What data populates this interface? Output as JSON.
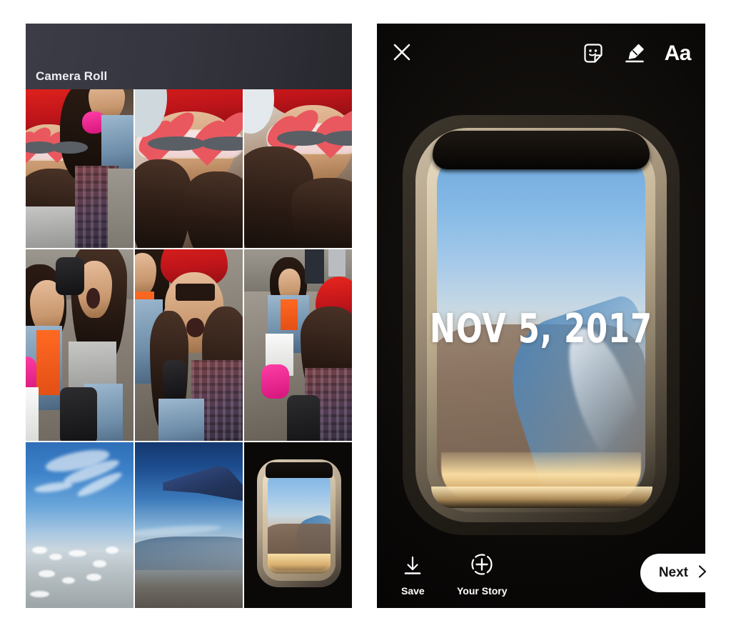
{
  "gallery": {
    "header_title": "Camera Roll",
    "photos": [
      {
        "id": "photo-1",
        "alt": "Two friends in red beanie and heart sunglasses selfie"
      },
      {
        "id": "photo-2",
        "alt": "Girl in red beanie with heart sunglasses close up"
      },
      {
        "id": "photo-3",
        "alt": "Girl with heart sunglasses and long hair"
      },
      {
        "id": "photo-4",
        "alt": "Two friends laughing and shouting at airport"
      },
      {
        "id": "photo-5",
        "alt": "Girl in red beanie smiling with friend behind"
      },
      {
        "id": "photo-6",
        "alt": "Friends walking with luggage at airport"
      },
      {
        "id": "photo-7",
        "alt": "Blue sky with wispy clouds from airplane"
      },
      {
        "id": "photo-8",
        "alt": "Airplane wing over coastline"
      },
      {
        "id": "photo-9",
        "alt": "Airplane window view of coastline"
      }
    ]
  },
  "story": {
    "toolbar": {
      "close_label": "Close",
      "sticker_label": "Stickers",
      "draw_label": "Draw",
      "text_label": "Aa"
    },
    "sticker_text": "NOV 5, 2017",
    "bottom": {
      "save_label": "Save",
      "your_story_label": "Your Story",
      "next_label": "Next"
    }
  },
  "colors": {
    "page_background": "#ffffff",
    "panel_background": "#000000",
    "gallery_header": "#35353f",
    "accent_white": "#ffffff",
    "next_button_text": "#141414"
  }
}
